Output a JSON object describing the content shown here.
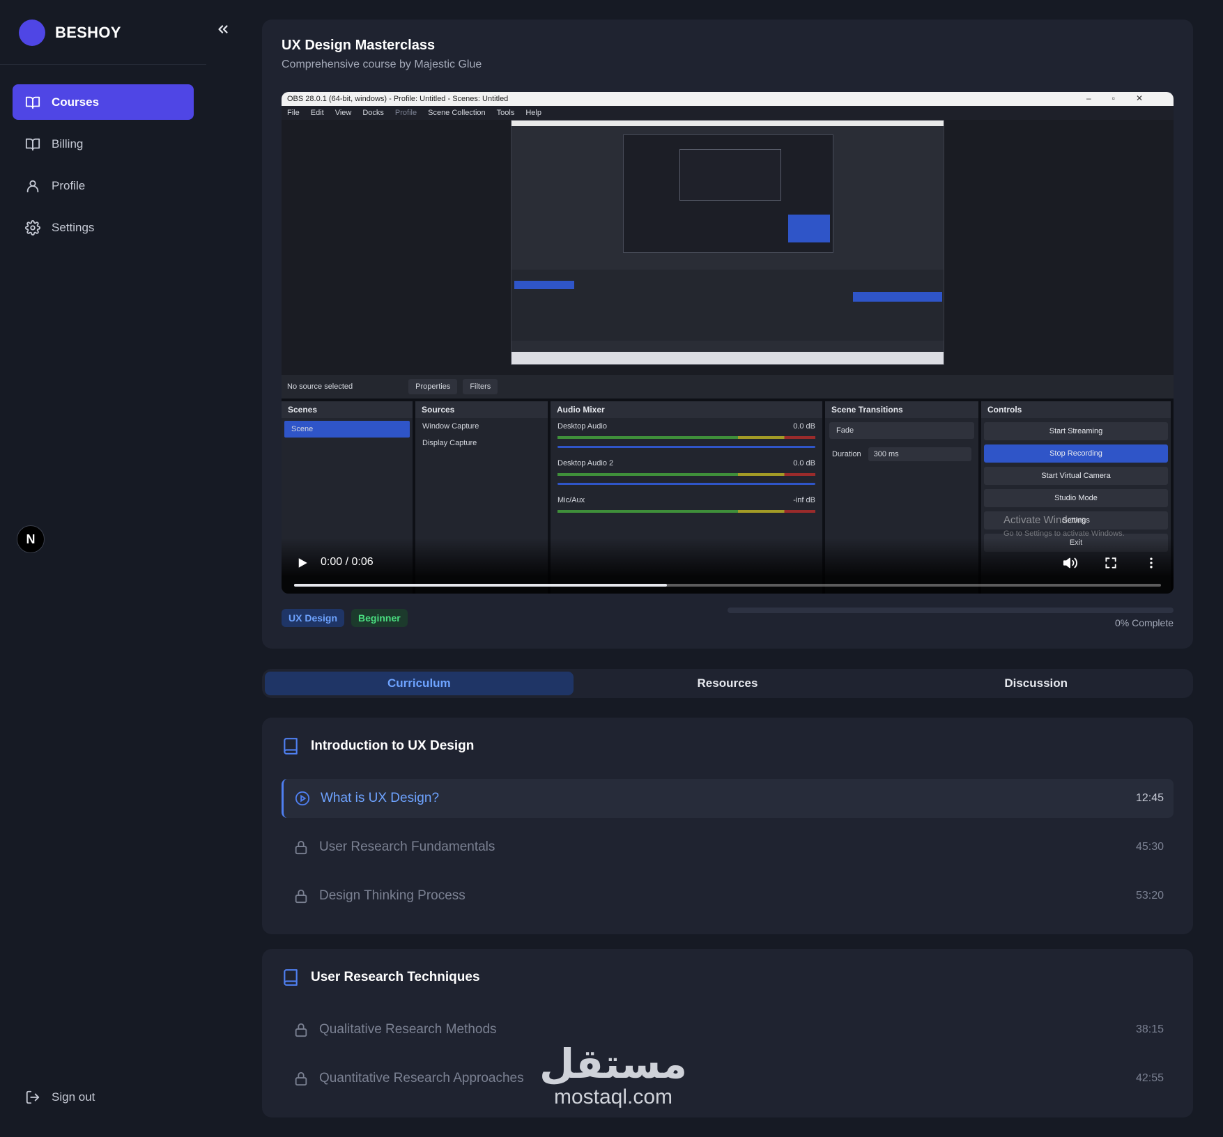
{
  "app": {
    "brand": "BESHOY",
    "avatar_initial": "N"
  },
  "sidebar": {
    "items": [
      {
        "label": "Courses",
        "icon": "book-open-icon",
        "active": true
      },
      {
        "label": "Billing",
        "icon": "book-icon",
        "active": false
      },
      {
        "label": "Profile",
        "icon": "user-icon",
        "active": false
      },
      {
        "label": "Settings",
        "icon": "gear-icon",
        "active": false
      }
    ],
    "signout_label": "Sign out"
  },
  "course": {
    "title": "UX Design Masterclass",
    "subtitle": "Comprehensive course by Majestic Glue",
    "tags": [
      "UX Design",
      "Beginner"
    ],
    "progress_percent": 0,
    "progress_label": "0% Complete"
  },
  "video": {
    "time_label": "0:00 / 0:06",
    "buffered_fraction": 0.43,
    "obs": {
      "window_title": "OBS 28.0.1 (64-bit, windows) - Profile: Untitled - Scenes: Untitled",
      "menu": [
        "File",
        "Edit",
        "View",
        "Docks",
        "Profile",
        "Scene Collection",
        "Tools",
        "Help"
      ],
      "status_text": "No source selected",
      "status_buttons": [
        "Properties",
        "Filters"
      ],
      "docks": {
        "scenes": {
          "title": "Scenes",
          "items": [
            "Scene"
          ]
        },
        "sources": {
          "title": "Sources",
          "items": [
            "Window Capture",
            "Display Capture"
          ]
        },
        "mixer": {
          "title": "Audio Mixer",
          "channels": [
            {
              "name": "Desktop Audio",
              "level": "0.0 dB"
            },
            {
              "name": "Desktop Audio 2",
              "level": "0.0 dB"
            },
            {
              "name": "Mic/Aux",
              "level": "-inf dB"
            }
          ]
        },
        "transitions": {
          "title": "Scene Transitions",
          "type": "Fade",
          "duration_label": "Duration",
          "duration": "300 ms"
        },
        "controls": {
          "title": "Controls",
          "buttons": [
            "Start Streaming",
            "Stop Recording",
            "Start Virtual Camera",
            "Studio Mode",
            "Settings",
            "Exit"
          ]
        }
      },
      "activate_title": "Activate Windows",
      "activate_sub": "Go to Settings to activate Windows."
    }
  },
  "tabs": [
    {
      "label": "Curriculum",
      "active": true
    },
    {
      "label": "Resources",
      "active": false
    },
    {
      "label": "Discussion",
      "active": false
    }
  ],
  "modules": [
    {
      "title": "Introduction to UX Design",
      "lessons": [
        {
          "title": "What is UX Design?",
          "duration": "12:45",
          "state": "playing"
        },
        {
          "title": "User Research Fundamentals",
          "duration": "45:30",
          "state": "locked"
        },
        {
          "title": "Design Thinking Process",
          "duration": "53:20",
          "state": "locked"
        }
      ]
    },
    {
      "title": "User Research Techniques",
      "lessons": [
        {
          "title": "Qualitative Research Methods",
          "duration": "38:15",
          "state": "locked"
        },
        {
          "title": "Quantitative Research Approaches",
          "duration": "42:55",
          "state": "locked"
        }
      ]
    }
  ],
  "watermark": {
    "logo_text": "مستقل",
    "text": "mostaql.com"
  },
  "colors": {
    "accent": "#4f46e5",
    "tab_active": "#6ea3ff",
    "tag_green": "#4ade80",
    "background": "#161a24",
    "card": "#1f2330"
  }
}
